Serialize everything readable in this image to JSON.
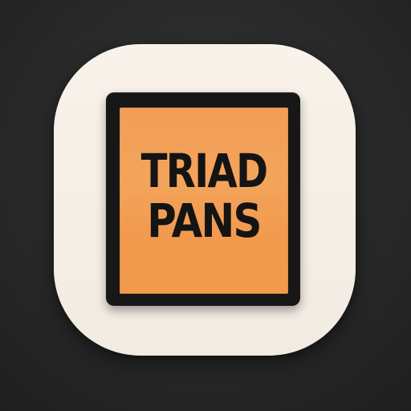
{
  "logo": {
    "line1": "TRIAD",
    "line2": "PANS",
    "colors": {
      "background": "#2b2b2b",
      "icon_base": "#f5efe7",
      "frame": "#171717",
      "card": "#f29d57",
      "text": "#141414"
    }
  }
}
